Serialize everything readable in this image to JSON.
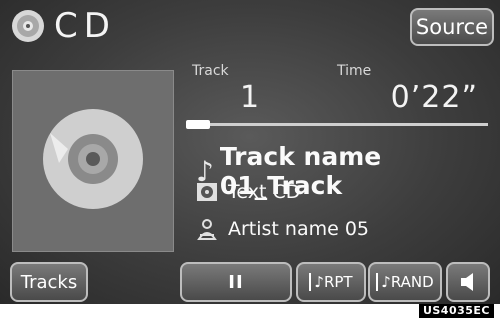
{
  "header": {
    "title": "CD",
    "source_label": "Source",
    "disc_icon": "cd-disc-icon"
  },
  "playback": {
    "track_label": "Track",
    "time_label": "Time",
    "track_number": "1",
    "time": "0’22”",
    "progress": 0.08
  },
  "info": {
    "track_name": "Track name 01_Track",
    "album": "Text CD",
    "artist": "Artist name 05",
    "track_icon": "music-note-icon",
    "album_icon": "disc-text-icon",
    "artist_icon": "person-icon"
  },
  "controls": {
    "tracks_label": "Tracks",
    "pause_label": "II",
    "rpt_label": "RPT",
    "rand_label": "RAND",
    "volume_icon": "speaker-icon"
  },
  "footer": {
    "caption": "US4035EC"
  },
  "colors": {
    "background": "#3d3d3d",
    "text": "#f4f4f4",
    "button_border": "#bdbdbd"
  }
}
